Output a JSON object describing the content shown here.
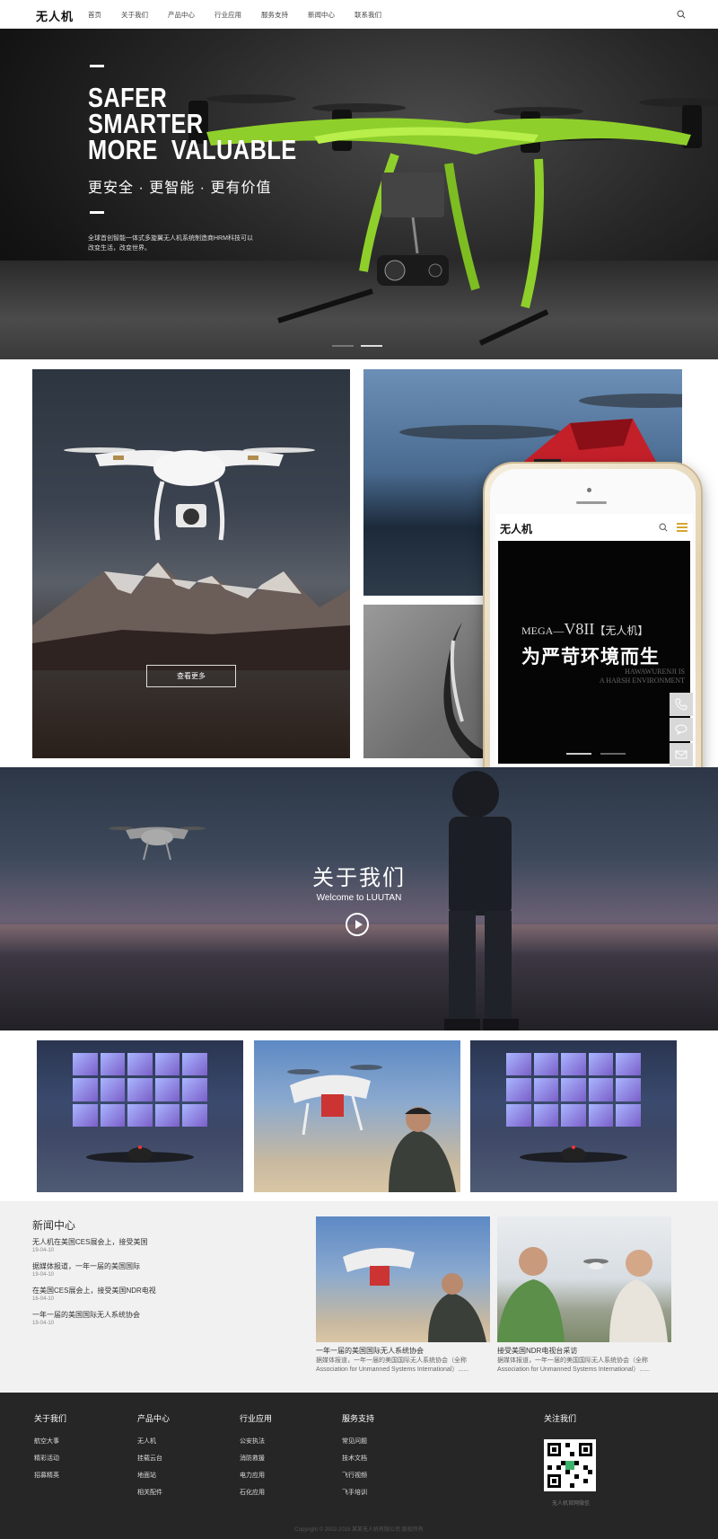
{
  "header": {
    "logo": "无人机",
    "nav": [
      "首页",
      "关于我们",
      "产品中心",
      "行业应用",
      "服务支持",
      "新闻中心",
      "联系我们"
    ]
  },
  "hero": {
    "line1": "SAFER",
    "line2": "SMARTER",
    "line3": "MORE  VALUABLE",
    "cn_title": "更安全 · 更智能 · 更有价值",
    "desc": "全球首创智能一体式多旋翼无人机系统制造商HRM科技可以改变生活，改变世界。",
    "slides": 2,
    "active_slide": 2
  },
  "gallery": {
    "more_label": "查看更多"
  },
  "phone": {
    "logo": "无人机",
    "mega": "MEGA—",
    "model": "V8II",
    "bracket": "【无人机】",
    "title": "为严苛环境而生",
    "sub1": "HAWAWURENJI IS",
    "sub2": "A HARSH ENVIRONMENT"
  },
  "about": {
    "title": "关于我们",
    "subtitle": "Welcome to LUUTAN"
  },
  "news": {
    "heading": "新闻中心",
    "items": [
      {
        "title": "无人机在美国CES展会上，接受美国",
        "date": "19-04-10"
      },
      {
        "title": "据媒体报道，一年一届的美国国际",
        "date": "19-04-10"
      },
      {
        "title": "在美国CES展会上，接受美国NDR电视",
        "date": "16-04-10"
      },
      {
        "title": "一年一届的美国国际无人系统协会",
        "date": "19-04-10"
      }
    ],
    "cards": [
      {
        "title": "一年一届的美国国际无人系统协会",
        "desc": "据媒体报道，一年一届的美国国际无人系统协会（全称Association for Unmanned Systems International）......"
      },
      {
        "title": "接受美国NDR电视台采访",
        "desc": "据媒体报道，一年一届的美国国际无人系统协会（全称Association for Unmanned Systems International）......"
      }
    ]
  },
  "footer": {
    "columns": [
      {
        "title": "关于我们",
        "links": [
          "航空大事",
          "精彩活动",
          "招募精英"
        ]
      },
      {
        "title": "产品中心",
        "links": [
          "无人机",
          "挂载云台",
          "地面站",
          "相关配件"
        ]
      },
      {
        "title": "行业应用",
        "links": [
          "公安执法",
          "消防救援",
          "电力应用",
          "石化应用"
        ]
      },
      {
        "title": "服务支持",
        "links": [
          "常见问题",
          "技术文档",
          "飞行视频",
          "飞手培训"
        ]
      }
    ],
    "follow_title": "关注我们",
    "qr_caption": "无人机官网微信",
    "copyright": "Copyright © 2002-2019 某某无人机有限公司 版权所有"
  },
  "colors": {
    "accent": "#d6a632",
    "drone_green": "#8fcf2b",
    "footer_bg": "#262626",
    "news_bg": "#f1f1f1"
  }
}
